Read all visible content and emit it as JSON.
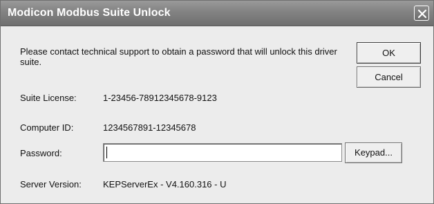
{
  "window": {
    "title": "Modicon Modbus Suite Unlock",
    "close_icon": "close-icon"
  },
  "message": "Please contact technical support to obtain a password that will unlock this driver suite.",
  "buttons": {
    "ok": "OK",
    "cancel": "Cancel",
    "keypad": "Keypad..."
  },
  "fields": {
    "suite_license": {
      "label": "Suite License:",
      "value": "1-23456-78912345678-9123"
    },
    "computer_id": {
      "label": "Computer ID:",
      "value": "1234567891-12345678"
    },
    "password": {
      "label": "Password:",
      "value": "",
      "placeholder": ""
    },
    "server_version": {
      "label": "Server Version:",
      "value": "KEPServerEx - V4.160.316 - U"
    }
  }
}
